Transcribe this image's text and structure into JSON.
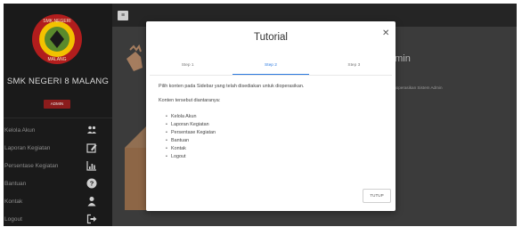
{
  "sidebar": {
    "logo_text": {
      "top": "SMK NEGERI",
      "bottom": "MALANG"
    },
    "school_name": "SMK NEGERI 8 MALANG",
    "role_badge": "ADMIN",
    "items": [
      {
        "label": "Kelola Akun",
        "icon": "users-icon"
      },
      {
        "label": "Laporan Kegiatan",
        "icon": "edit-icon"
      },
      {
        "label": "Persentase Kegiatan",
        "icon": "bar-chart-icon"
      },
      {
        "label": "Bantuan",
        "icon": "question-icon"
      },
      {
        "label": "Kontak",
        "icon": "user-icon"
      },
      {
        "label": "Logout",
        "icon": "logout-icon"
      }
    ]
  },
  "main": {
    "title": "dmin",
    "subtitle": "nggoperasikan Sistem Admin"
  },
  "modal": {
    "title": "Tutorial",
    "steps": [
      "Step 1",
      "Step 2",
      "Step 3"
    ],
    "active_step": 2,
    "intro": "Pilih konten pada Sidebar yang telah disediakan untuk dioperasikan.",
    "list_heading": "Konten tersebut diantaranya:",
    "items": [
      "Kelola Akun",
      "Laporan Kegiatan",
      "Persentase Kegiatan",
      "Bantuan",
      "Kontak",
      "Logout"
    ],
    "close_button": "TUTUP"
  },
  "colors": {
    "accent": "#2d7be0",
    "badge": "#8b1c1c",
    "sidebar_bg": "#1a1a1a",
    "overlay_bg": "#3b3b3b"
  }
}
